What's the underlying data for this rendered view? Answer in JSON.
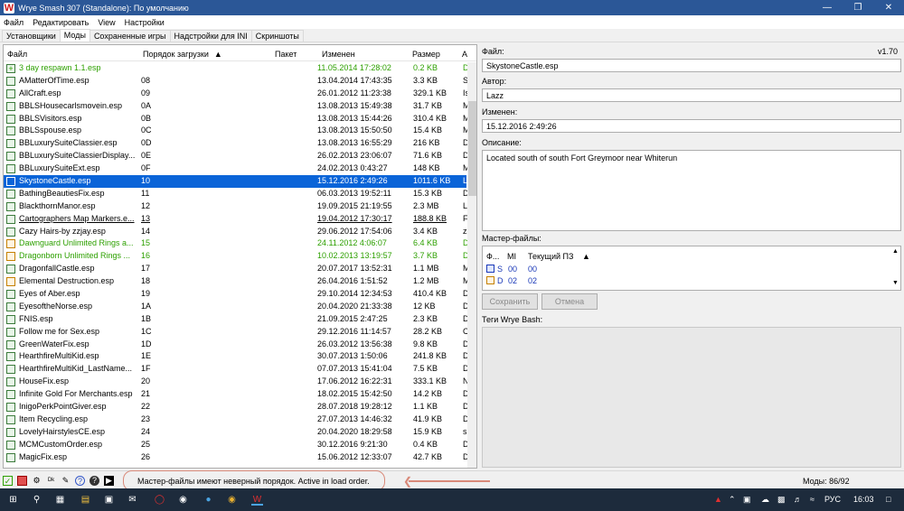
{
  "window": {
    "title": "Wrye Smash 307 (Standalone): По умолчанию",
    "icon": "app-logo-icon"
  },
  "menu": [
    "Файл",
    "Редактировать",
    "View",
    "Настройки"
  ],
  "tabs": [
    "Установщики",
    "Моды",
    "Сохраненные игры",
    "Надстройки для INI",
    "Скриншоты"
  ],
  "active_tab": "Моды",
  "columns": {
    "file": "Файл",
    "order": "Порядок загрузки",
    "package": "Пакет",
    "modified": "Изменен",
    "size": "Размер",
    "a": "A"
  },
  "rows": [
    {
      "name": "3 day respawn 1.1.esp",
      "order": "",
      "modified": "11.05.2014 17:28:02",
      "size": "0.2 KB",
      "a": "D",
      "style": "green"
    },
    {
      "name": "AMatterOfTime.esp",
      "order": "08",
      "modified": "13.04.2014 17:43:35",
      "size": "3.3 KB",
      "a": "S",
      "style": ""
    },
    {
      "name": "AllCraft.esp",
      "order": "09",
      "modified": "26.01.2012 11:23:38",
      "size": "329.1 KB",
      "a": "Is",
      "style": ""
    },
    {
      "name": "BBLSHousecarlsmovein.esp",
      "order": "0A",
      "modified": "13.08.2013 15:49:38",
      "size": "31.7 KB",
      "a": "M",
      "style": ""
    },
    {
      "name": "BBLSVisitors.esp",
      "order": "0B",
      "modified": "13.08.2013 15:44:26",
      "size": "310.4 KB",
      "a": "M",
      "style": ""
    },
    {
      "name": "BBLSspouse.esp",
      "order": "0C",
      "modified": "13.08.2013 15:50:50",
      "size": "15.4 KB",
      "a": "M",
      "style": ""
    },
    {
      "name": "BBLuxurySuiteClassier.esp",
      "order": "0D",
      "modified": "13.08.2013 16:55:29",
      "size": "216 KB",
      "a": "D",
      "style": ""
    },
    {
      "name": "BBLuxurySuiteClassierDisplay...",
      "order": "0E",
      "modified": "26.02.2013 23:06:07",
      "size": "71.6 KB",
      "a": "D",
      "style": ""
    },
    {
      "name": "BBLuxurySuiteExt.esp",
      "order": "0F",
      "modified": "24.02.2013 0:43:27",
      "size": "148 KB",
      "a": "M",
      "style": ""
    },
    {
      "name": "SkystoneCastle.esp",
      "order": "10",
      "modified": "15.12.2016 2:49:26",
      "size": "1011.6 KB",
      "a": "La",
      "style": "sel"
    },
    {
      "name": "BathingBeautiesFix.esp",
      "order": "11",
      "modified": "06.03.2013 19:52:11",
      "size": "15.3 KB",
      "a": "D",
      "style": ""
    },
    {
      "name": "BlackthornManor.esp",
      "order": "12",
      "modified": "19.09.2015 21:19:55",
      "size": "2.3 MB",
      "a": "Lo",
      "style": ""
    },
    {
      "name": "Cartographers Map Markers.e...",
      "order": "13",
      "modified": "19.04.2012 17:30:17",
      "size": "188.8 KB",
      "a": "Fe",
      "style": "ul"
    },
    {
      "name": "Cazy Hairs-by zzjay.esp",
      "order": "14",
      "modified": "29.06.2012 17:54:06",
      "size": "3.4 KB",
      "a": "zz",
      "style": ""
    },
    {
      "name": "Dawnguard Unlimited Rings a...",
      "order": "15",
      "modified": "24.11.2012 4:06:07",
      "size": "6.4 KB",
      "a": "D",
      "style": "green orange"
    },
    {
      "name": "Dragonborn Unlimited Rings ...",
      "order": "16",
      "modified": "10.02.2013 13:19:57",
      "size": "3.7 KB",
      "a": "D",
      "style": "green orange"
    },
    {
      "name": "DragonfallCastle.esp",
      "order": "17",
      "modified": "20.07.2017 13:52:31",
      "size": "1.1 MB",
      "a": "M",
      "style": ""
    },
    {
      "name": "Elemental Destruction.esp",
      "order": "18",
      "modified": "26.04.2016 1:51:52",
      "size": "1.2 MB",
      "a": "M",
      "style": "orange"
    },
    {
      "name": "Eyes of Aber.esp",
      "order": "19",
      "modified": "29.10.2014 12:34:53",
      "size": "410.4 KB",
      "a": "D",
      "style": ""
    },
    {
      "name": "EyesoftheNorse.esp",
      "order": "1A",
      "modified": "20.04.2020 21:33:38",
      "size": "12 KB",
      "a": "D",
      "style": ""
    },
    {
      "name": "FNIS.esp",
      "order": "1B",
      "modified": "21.09.2015 2:47:25",
      "size": "2.3 KB",
      "a": "D",
      "style": ""
    },
    {
      "name": "Follow me for Sex.esp",
      "order": "1C",
      "modified": "29.12.2016 11:14:57",
      "size": "28.2 KB",
      "a": "C",
      "style": ""
    },
    {
      "name": "GreenWaterFix.esp",
      "order": "1D",
      "modified": "26.03.2012 13:56:38",
      "size": "9.8 KB",
      "a": "D",
      "style": ""
    },
    {
      "name": "HearthfireMultiKid.esp",
      "order": "1E",
      "modified": "30.07.2013 1:50:06",
      "size": "241.8 KB",
      "a": "D",
      "style": ""
    },
    {
      "name": "HearthfireMultiKid_LastName...",
      "order": "1F",
      "modified": "07.07.2013 15:41:04",
      "size": "7.5 KB",
      "a": "D",
      "style": ""
    },
    {
      "name": "HouseFix.esp",
      "order": "20",
      "modified": "17.06.2012 16:22:31",
      "size": "333.1 KB",
      "a": "N",
      "style": ""
    },
    {
      "name": "Infinite Gold For Merchants.esp",
      "order": "21",
      "modified": "18.02.2015 15:42:50",
      "size": "14.2 KB",
      "a": "D",
      "style": ""
    },
    {
      "name": "InigoPerkPointGiver.esp",
      "order": "22",
      "modified": "28.07.2018 19:28:12",
      "size": "1.1 KB",
      "a": "D",
      "style": ""
    },
    {
      "name": "Item Recycling.esp",
      "order": "23",
      "modified": "27.07.2013 14:46:32",
      "size": "41.9 KB",
      "a": "D",
      "style": ""
    },
    {
      "name": "LovelyHairstylesCE.esp",
      "order": "24",
      "modified": "20.04.2020 18:29:58",
      "size": "15.9 KB",
      "a": "sr",
      "style": ""
    },
    {
      "name": "MCMCustomOrder.esp",
      "order": "25",
      "modified": "30.12.2016 9:21:30",
      "size": "0.4 KB",
      "a": "D",
      "style": ""
    },
    {
      "name": "MagicFix.esp",
      "order": "26",
      "modified": "15.06.2012 12:33:07",
      "size": "42.7 KB",
      "a": "D",
      "style": ""
    }
  ],
  "details": {
    "file_label": "Файл:",
    "version": "v1.70",
    "file_value": "SkystoneCastle.esp",
    "author_label": "Автор:",
    "author_value": "Lazz",
    "modified_label": "Изменен:",
    "modified_value": "15.12.2016 2:49:26",
    "description_label": "Описание:",
    "description_value": "Located south of south Fort Greymoor near Whiterun",
    "masters_label": "Мастер-файлы:",
    "masters_columns": {
      "f": "Ф...",
      "mi": "MI",
      "current": "Текущий ПЗ"
    },
    "masters_rows": [
      {
        "f": "S",
        "mi": "00",
        "current": "00"
      },
      {
        "f": "D",
        "mi": "02",
        "current": "02"
      }
    ],
    "save_button": "Сохранить",
    "cancel_button": "Отмена",
    "tags_label": "Теги Wrye Bash:"
  },
  "status": {
    "message": "Мастер-файлы имеют неверный порядок.  Active in load order.",
    "mods_count": "Моды: 86/92"
  },
  "taskbar": {
    "lang": "РУС",
    "time": "16:03"
  },
  "colors": {
    "title_bar": "#2b5797",
    "selection": "#0a64d8",
    "green_text": "#2da000",
    "annotation": "#d98a7a",
    "taskbar": "#1d2b3c"
  }
}
